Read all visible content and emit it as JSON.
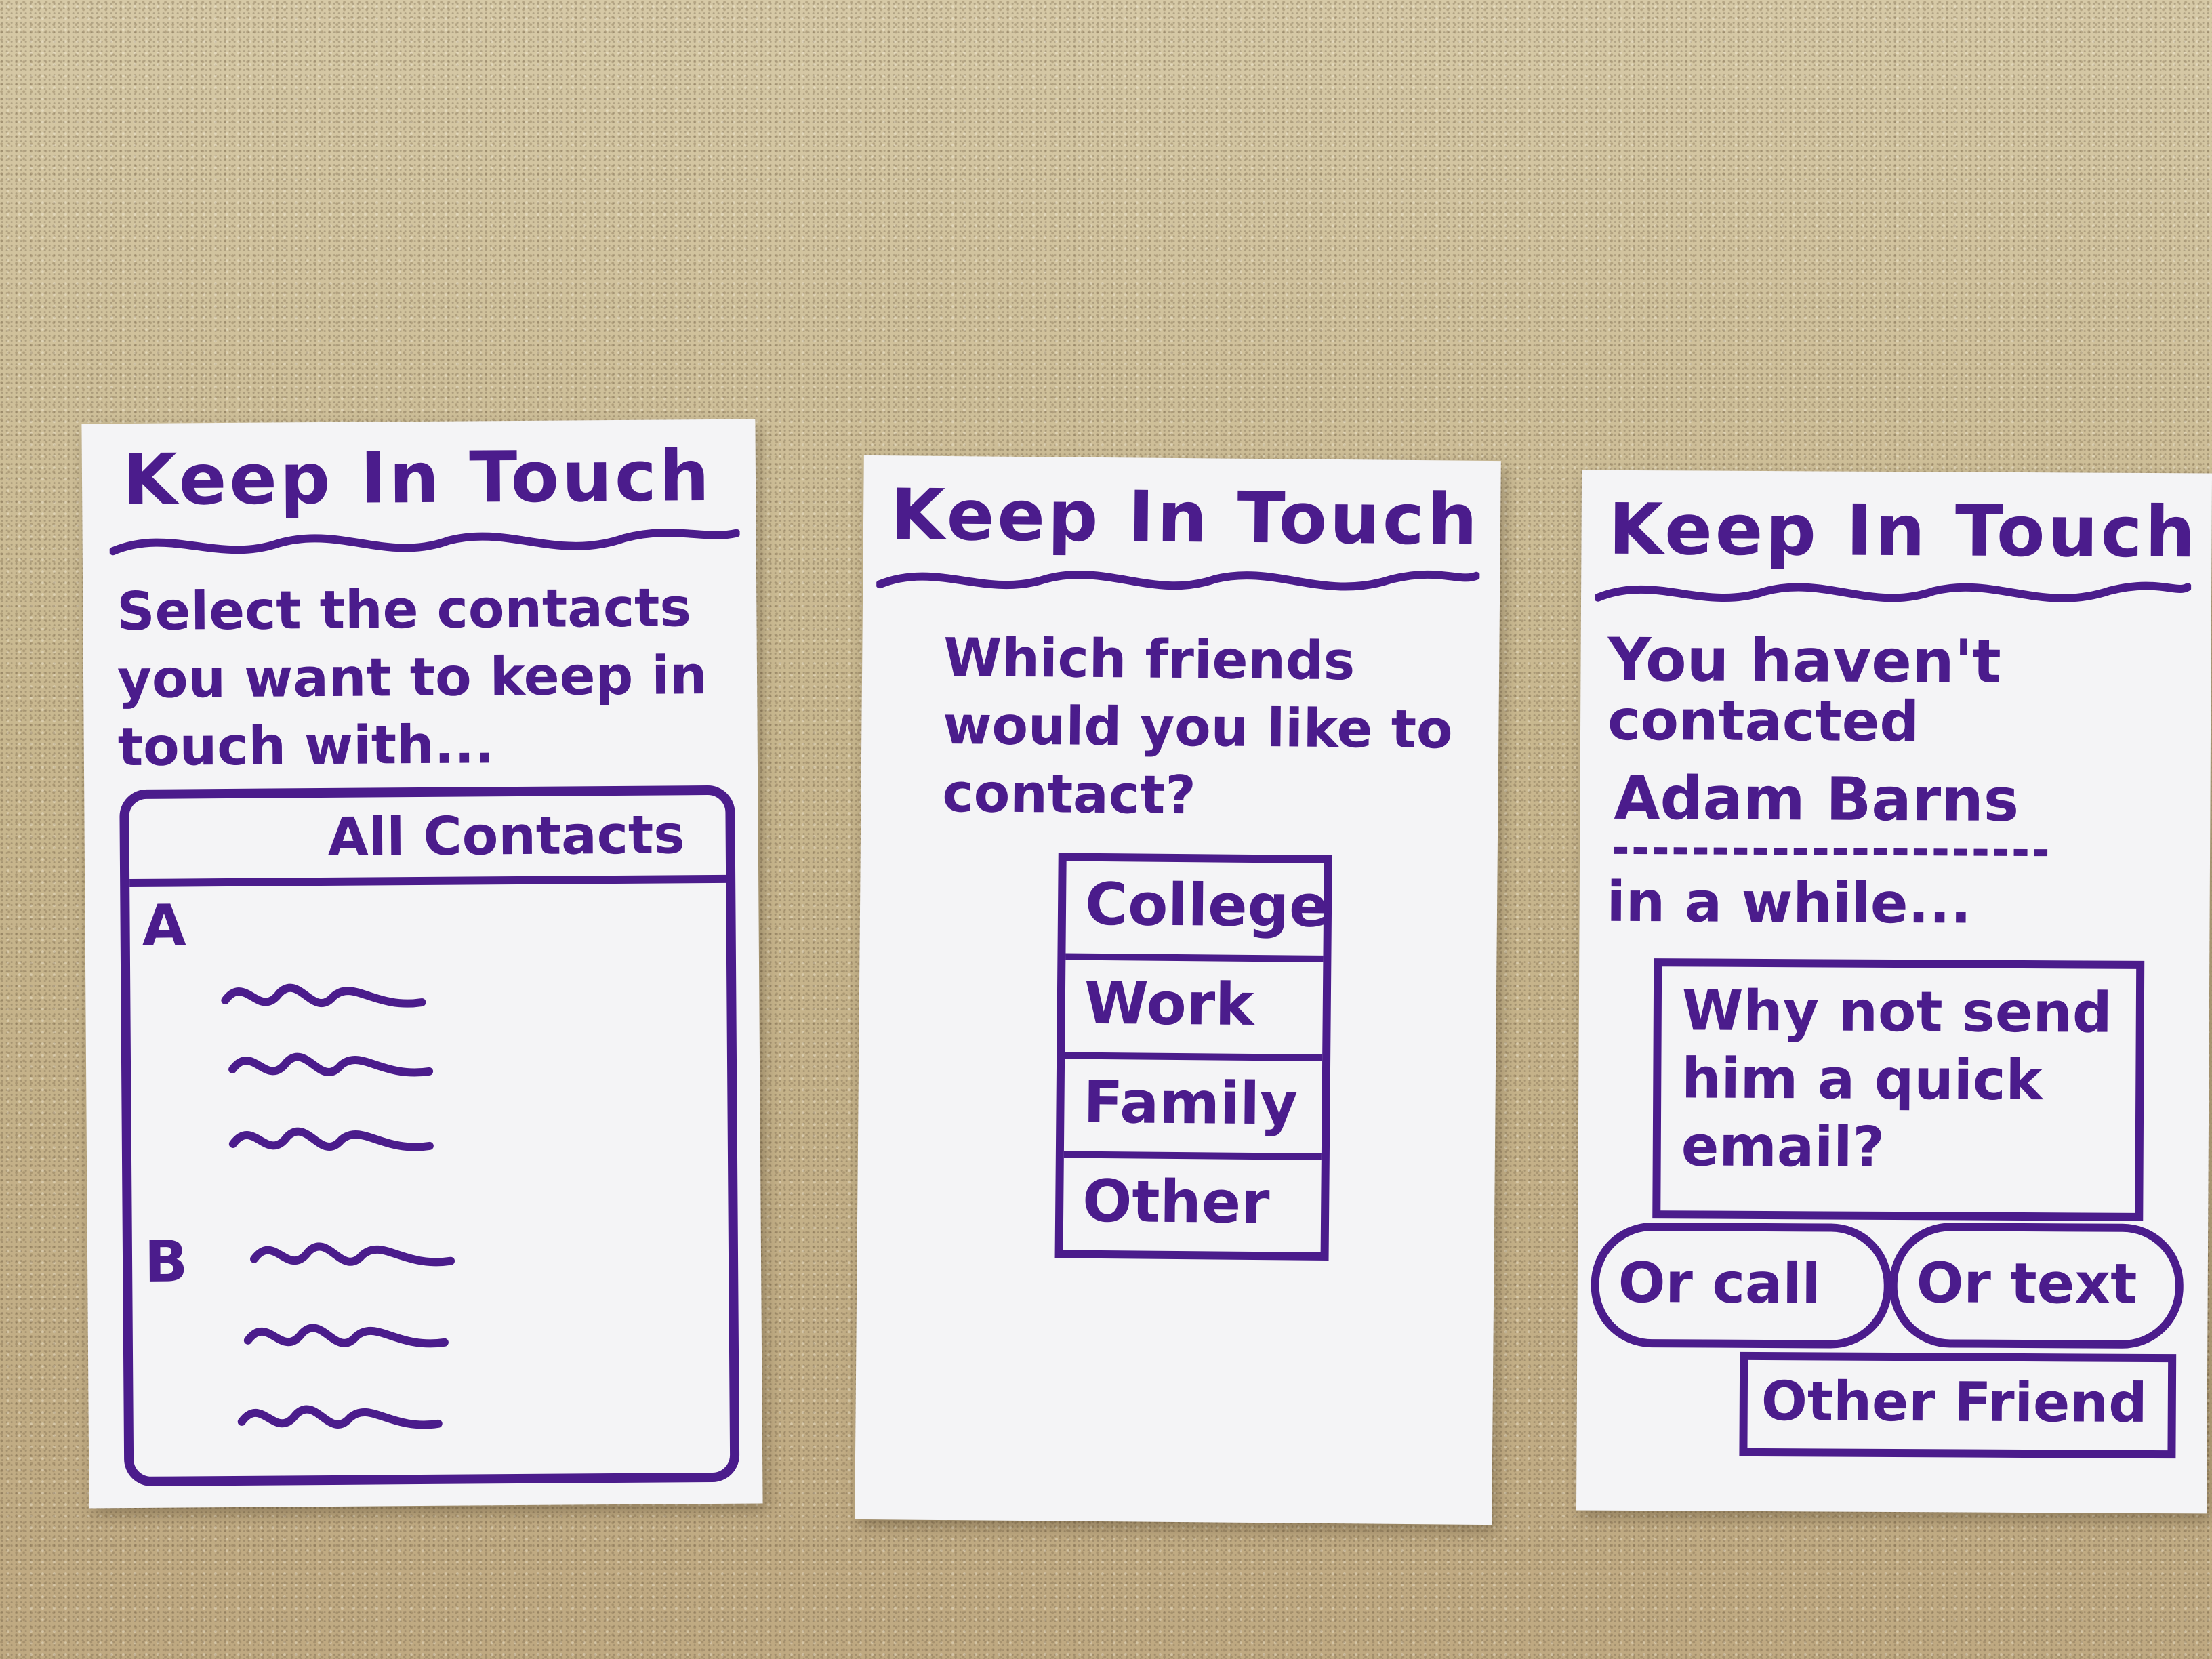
{
  "app": {
    "title": "Keep In Touch"
  },
  "screen1": {
    "title": "Keep In Touch",
    "instruction": "Select the contacts you want to keep in touch with...",
    "list_header": "All Contacts",
    "sections": [
      {
        "letter": "A",
        "placeholder_rows": 3
      },
      {
        "letter": "B",
        "placeholder_rows": 3
      }
    ]
  },
  "screen2": {
    "title": "Keep In Touch",
    "question": "Which friends would you like to contact?",
    "groups": [
      "College",
      "Work",
      "Family",
      "Other"
    ]
  },
  "screen3": {
    "title": "Keep In Touch",
    "line1": "You haven't",
    "line2": "contacted",
    "contact_name": "Adam Barns",
    "line3": "in a while...",
    "suggestion": "Why not send him a quick email?",
    "call_button": "Or call",
    "text_button": "Or text",
    "other_button": "Other Friend"
  },
  "colors": {
    "ink": "#4b1c8c",
    "paper": "#f4f4f6",
    "counter": "#c9b88f"
  }
}
